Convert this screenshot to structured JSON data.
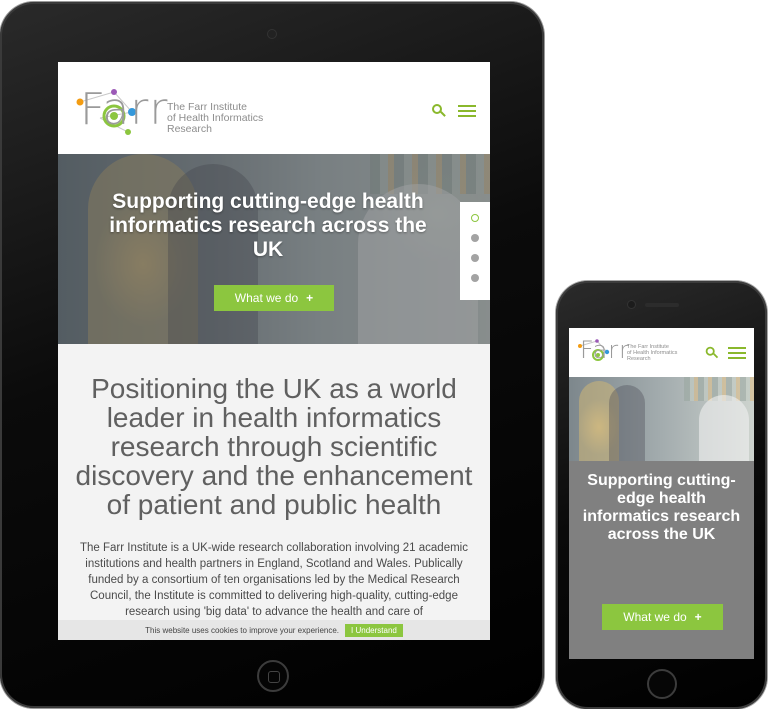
{
  "brand": {
    "word": "Farr",
    "sub_line1": "The Farr Institute",
    "sub_line2": "of Health Informatics",
    "sub_line3": "Research",
    "accent": "#8cc63f",
    "logo_dot_colors": [
      "#f39c12",
      "#8cc63f",
      "#9b59b6",
      "#3498db"
    ]
  },
  "icons": {
    "search": "search-icon",
    "menu": "hamburger-menu-icon"
  },
  "hero": {
    "title": "Supporting cutting-edge health informatics research across the UK",
    "button_label": "What we do",
    "button_icon": "+",
    "slides": 4,
    "active_slide": 1
  },
  "intro": {
    "heading": "Positioning the UK as a world leader in health informatics research through scientific discovery and the enhancement of patient and public health",
    "paragraph": "The Farr Institute is a UK-wide research collaboration involving 21 academic institutions and health partners in England, Scotland and Wales. Publically funded by a consortium of ten organisations led by the Medical Research Council, the Institute is committed to delivering high-quality, cutting-edge research using 'big data' to advance the health and care of"
  },
  "cookie": {
    "message": "This website uses cookies to improve your experience.",
    "button": "I Understand"
  },
  "phone": {
    "title": "Supporting cutting-edge health informatics research across the UK",
    "button_label": "What we do",
    "button_icon": "+"
  }
}
